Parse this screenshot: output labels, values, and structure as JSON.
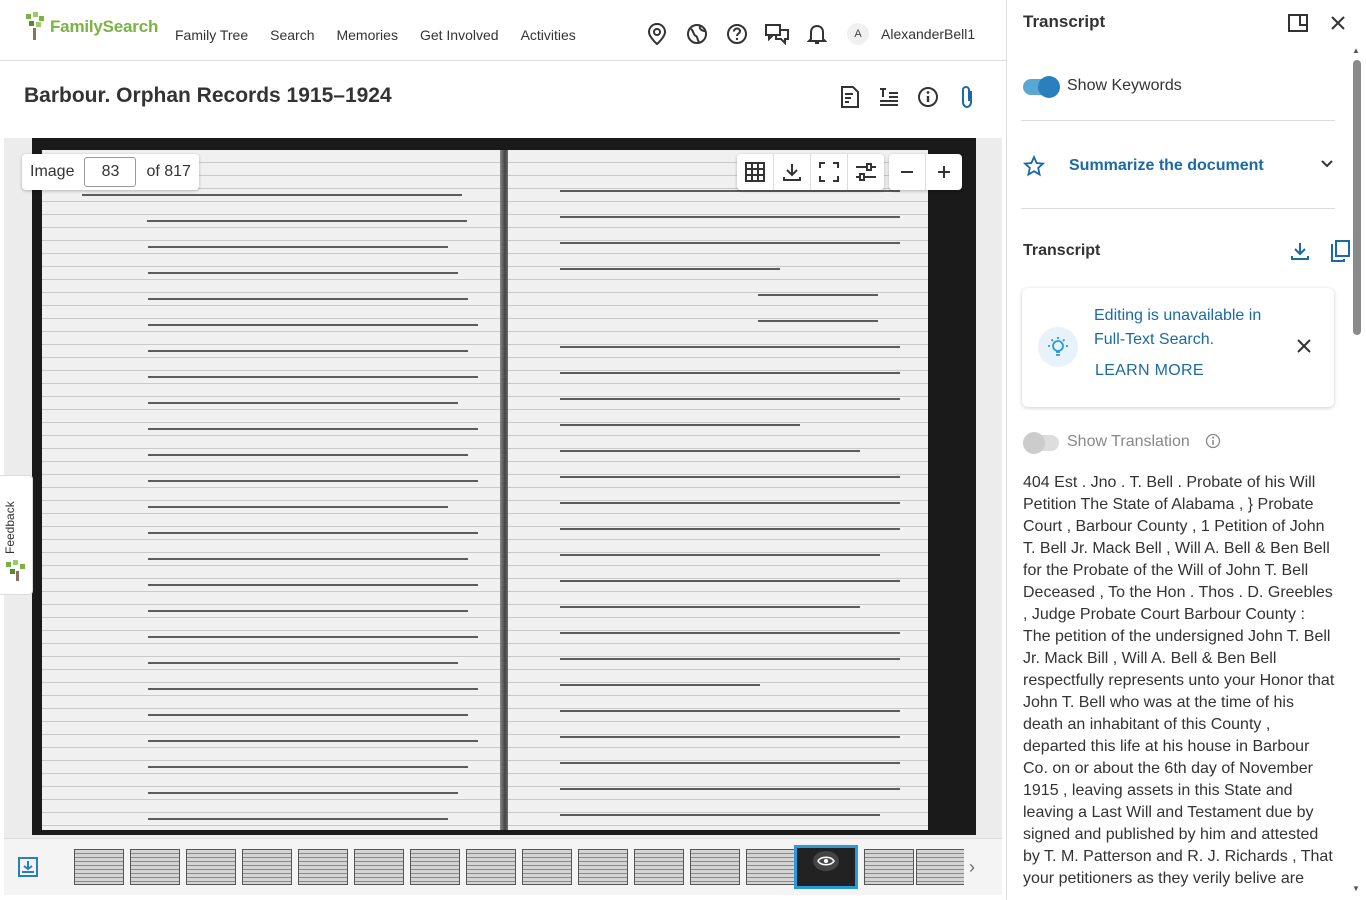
{
  "header": {
    "logo_text": "FamilySearch",
    "nav": [
      "Family Tree",
      "Search",
      "Memories",
      "Get Involved",
      "Activities"
    ],
    "avatar_initial": "A",
    "username": "AlexanderBell1"
  },
  "record": {
    "title": "Barbour. Orphan Records 1915–1924"
  },
  "viewer": {
    "image_label": "Image",
    "image_number": "83",
    "image_total": "of 817",
    "feedback_label": "Feedback"
  },
  "filmstrip": {
    "prev": "‹",
    "next": "›"
  },
  "panel": {
    "title": "Transcript",
    "show_keywords": "Show Keywords",
    "summarize": "Summarize the document",
    "transcript_heading": "Transcript",
    "notice_text": "Editing is unavailable in Full-Text Search.",
    "learn_more": "LEARN MORE",
    "show_translation": "Show Translation",
    "transcript_body": "404 Est . Jno . T. Bell . Probate of his Will Petition The State of Alabama , } Probate Court , Barbour County , 1 Petition of John T. Bell Jr. Mack Bell , Will A. Bell & Ben Bell for the Probate of the Will of John T. Bell Deceased , To the Hon . Thos . D. Greebles , Judge Probate Court Barbour County : The petition of the undersigned John T. Bell Jr. Mack Bill , Will A. Bell & Ben Bell respectfully represents unto your Honor that John T. Bell who was at the time of his death an inhabitant of this County , departed this life at his house in Barbour Co. on or about the 6th day of November 1915 , leaving assets in this State and leaving a Last Will and Testament due by signed and published by him and attested by T. M. Patterson and R. J. Richards , That your petitioners as they verily belive are"
  },
  "colors": {
    "brand_green": "#7bb342",
    "link_blue": "#1a6aa5",
    "selected_thumb": "#2a9bd8"
  }
}
